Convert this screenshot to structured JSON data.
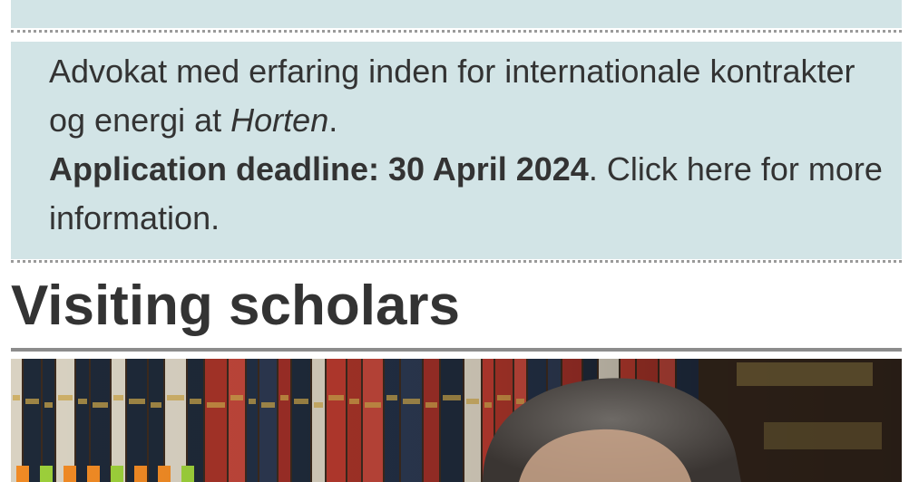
{
  "job_listing": {
    "text_line1": "Advokat med erfaring inden for internationale kontrakter og energi at ",
    "firm": "Horten",
    "text_end": ".",
    "deadline": "Application deadline: 30 April 2024",
    "cta": ". Click here for more information."
  },
  "section": {
    "title": "Visiting scholars"
  },
  "photo": {
    "subject": "scholar in front of law book shelves"
  },
  "colors": {
    "box_background": "#d2e4e6",
    "text": "#333333",
    "rule": "#8c8c8c"
  }
}
